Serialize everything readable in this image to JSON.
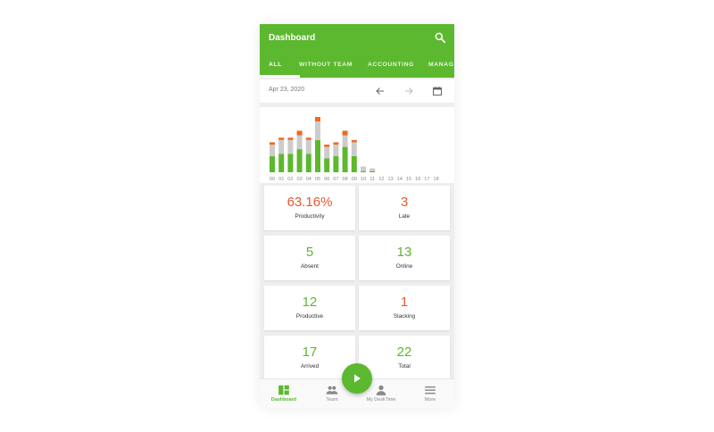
{
  "app": {
    "title": "Dashboard"
  },
  "tabs": [
    {
      "label": "ALL",
      "active": true
    },
    {
      "label": "WITHOUT TEAM"
    },
    {
      "label": "ACCOUNTING"
    },
    {
      "label": "MANAGEMENT"
    }
  ],
  "date": {
    "label": "Apr 23, 2020"
  },
  "icons": {
    "search": "search-icon",
    "prev": "arrow-left-icon",
    "next": "arrow-right-icon",
    "calendar": "calendar-icon",
    "play": "play-icon"
  },
  "colors": {
    "accent": "#5cb82e",
    "productive": "#5cb82e",
    "neutral": "#cccccc",
    "slacking": "#f06a1f",
    "alert": "#e4572e"
  },
  "chart_data": {
    "type": "bar",
    "stacked": true,
    "categories": [
      "00",
      "01",
      "02",
      "03",
      "04",
      "05",
      "06",
      "07",
      "08",
      "09",
      "10",
      "11",
      "12",
      "13",
      "14",
      "15",
      "16",
      "17",
      "18"
    ],
    "series": [
      {
        "color": "#5cb82e",
        "values": [
          7,
          8,
          8,
          10,
          8,
          14,
          6,
          7,
          11,
          7,
          0.5,
          0.5,
          0,
          0,
          0,
          0,
          0,
          0,
          0
        ]
      },
      {
        "color": "#cccccc",
        "values": [
          5,
          6,
          6,
          6,
          6,
          8,
          5,
          5,
          5,
          6,
          2,
          1.2,
          0,
          0,
          0,
          0,
          0,
          0,
          0
        ]
      },
      {
        "color": "#f06a1f",
        "values": [
          1,
          1,
          1,
          2,
          1,
          2,
          1,
          1,
          2,
          1,
          0,
          0,
          0,
          0,
          0,
          0,
          0,
          0,
          0
        ]
      }
    ],
    "ylim": [
      0,
      24
    ]
  },
  "stats": [
    {
      "value": "63.16%",
      "label": "Productivity",
      "color": "red"
    },
    {
      "value": "3",
      "label": "Late",
      "color": "red"
    },
    {
      "value": "5",
      "label": "Absent",
      "color": "green"
    },
    {
      "value": "13",
      "label": "Online",
      "color": "green"
    },
    {
      "value": "12",
      "label": "Productive",
      "color": "green"
    },
    {
      "value": "1",
      "label": "Slacking",
      "color": "red"
    },
    {
      "value": "17",
      "label": "Arrived",
      "color": "green"
    },
    {
      "value": "22",
      "label": "Total",
      "color": "green"
    }
  ],
  "nav": [
    {
      "label": "Dashboard",
      "icon": "dashboard-icon",
      "active": true
    },
    {
      "label": "Team",
      "icon": "team-icon"
    },
    {
      "label": "My DeskTime",
      "icon": "person-icon"
    },
    {
      "label": "More",
      "icon": "menu-icon"
    }
  ]
}
